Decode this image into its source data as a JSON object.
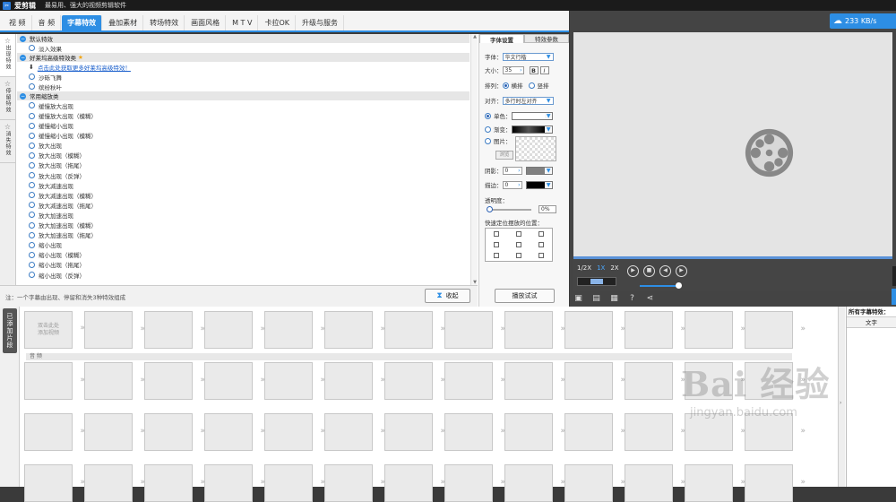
{
  "app": {
    "name": "爱剪辑",
    "slogan": "最易用、强大的视频剪辑软件"
  },
  "tabs": [
    {
      "label": "视 频"
    },
    {
      "label": "音 频"
    },
    {
      "label": "字幕特效",
      "active": true
    },
    {
      "label": "叠加素材"
    },
    {
      "label": "转场特效"
    },
    {
      "label": "画面风格"
    },
    {
      "label": "M T V"
    },
    {
      "label": "卡拉OK"
    },
    {
      "label": "升级与服务"
    }
  ],
  "side_tabs": [
    {
      "label": "出现特效",
      "active": true
    },
    {
      "label": "停留特效"
    },
    {
      "label": "消失特效"
    }
  ],
  "effects": {
    "group_default": "默认特效",
    "default_items": [
      "淡入效果"
    ],
    "group_hollywood": "好莱坞高级特效类",
    "download_link": "点击此处获取更多好莱坞高级特效！",
    "hollywood_items": [
      "沙砾飞舞",
      "缤纷秋叶"
    ],
    "group_common": "常用缩放类",
    "common_items": [
      "缓慢放大出现",
      "缓慢放大出现（模糊）",
      "缓慢缩小出现",
      "缓慢缩小出现（模糊）",
      "放大出现",
      "放大出现（模糊）",
      "放大出现（拖尾）",
      "放大出现（反弹）",
      "放大减速出现",
      "放大减速出现（模糊）",
      "放大减速出现（拖尾）",
      "放大加速出现",
      "放大加速出现（模糊）",
      "放大加速出现（拖尾）",
      "缩小出现",
      "缩小出现（模糊）",
      "缩小出现（拖尾）",
      "缩小出现（反弹）"
    ]
  },
  "note": "注：一个字幕由出现、停留和消失3种特效组成",
  "collapse_label": "收起",
  "settings": {
    "tab_font": "字体设置",
    "tab_params": "特效参数",
    "font_label": "字体：",
    "font_value": "华文行楷",
    "size_label": "大小：",
    "size_value": "35",
    "bold": "B",
    "italic": "I",
    "layout_label": "排列：",
    "layout_horizontal": "横排",
    "layout_vertical": "竖排",
    "align_label": "对齐：",
    "align_value": "多行时左对齐",
    "solid_label": "单色：",
    "gradient_label": "渐变：",
    "image_label": "图片：",
    "browse_label": "浏览",
    "shadow_label": "阴影：",
    "shadow_value": "0",
    "stroke_label": "描边：",
    "stroke_value": "0",
    "opacity_label": "透明度：",
    "opacity_value": "0%",
    "position_label": "快速定位摆放的位置：",
    "play_try": "播放试试",
    "colors": {
      "solid": "#ffffff",
      "gradient_start": "#000000",
      "shadow": "#808080",
      "stroke": "#000000"
    }
  },
  "player": {
    "speed": "233 KB/s",
    "speed_options": [
      "1/2X",
      "1X",
      "2X"
    ],
    "selected_speed": "1X",
    "volume": 0.7,
    "progress": 0.0
  },
  "timeline": {
    "tab_label": "已添加片段",
    "first_clip_line1": "双击此处",
    "first_clip_line2": "添加视频",
    "audio_label": "音 频",
    "clips_per_row": 13
  },
  "subtitles_panel": {
    "title": "所有字幕特效：",
    "column": "文字"
  },
  "watermark": {
    "big": "Bai 经验",
    "small": "jingyan.baidu.com"
  }
}
